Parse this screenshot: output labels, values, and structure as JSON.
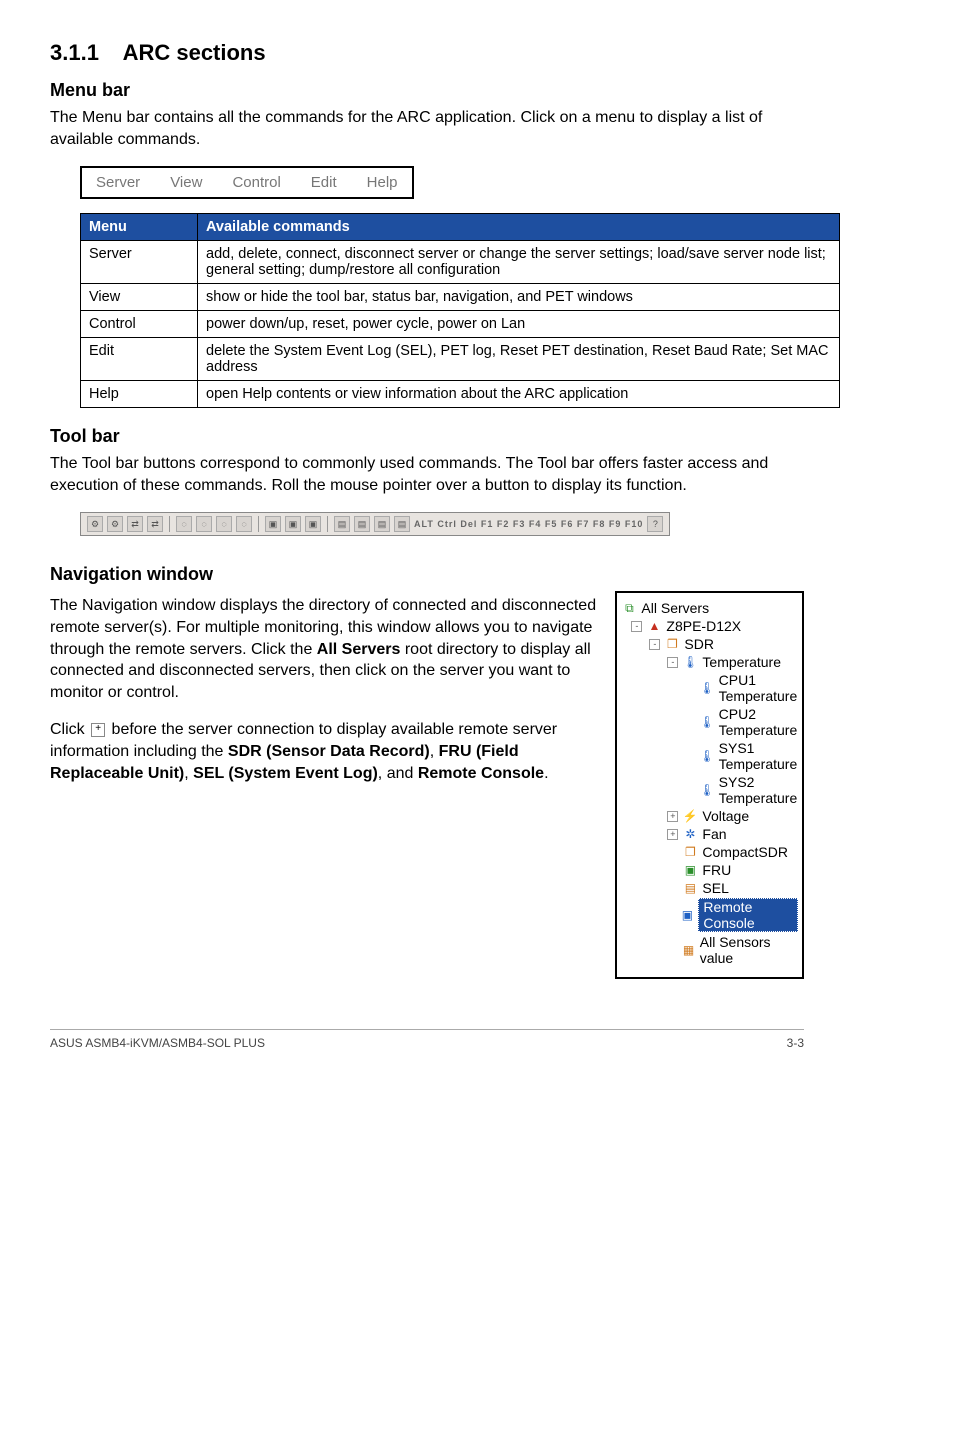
{
  "heading": {
    "num": "3.1.1",
    "title": "ARC sections"
  },
  "menubar": {
    "title": "Menu bar",
    "body": "The Menu bar contains all the commands for the ARC application. Click on a menu to display a list of available commands.",
    "items": [
      "Server",
      "View",
      "Control",
      "Edit",
      "Help"
    ]
  },
  "commands_table": {
    "head_menu": "Menu",
    "head_avail": "Available commands",
    "rows": [
      {
        "menu": "Server",
        "desc": "add, delete, connect, disconnect server or change the server settings; load/save server node list; general setting; dump/restore all configuration"
      },
      {
        "menu": "View",
        "desc": "show or hide the tool bar, status bar, navigation, and PET windows"
      },
      {
        "menu": "Control",
        "desc": "power down/up, reset, power cycle, power on Lan"
      },
      {
        "menu": "Edit",
        "desc": "delete the System Event Log (SEL), PET log, Reset PET destination, Reset Baud Rate; Set MAC address"
      },
      {
        "menu": "Help",
        "desc": "open Help contents or view information about the ARC application"
      }
    ]
  },
  "toolbar": {
    "title": "Tool bar",
    "body": "The Tool bar buttons correspond to commonly used commands. The Tool bar offers faster access and execution of these commands. Roll the mouse pointer over a button to display its function.",
    "key_labels": "ALT Ctrl Del F1 F2 F3 F4 F5 F6 F7 F8 F9 F10"
  },
  "navigation": {
    "title": "Navigation window",
    "p1_a": "The Navigation window displays the directory of connected and disconnected remote server(s). For multiple monitoring, this window allows you to navigate through the remote servers. Click the ",
    "p1_bold": "All Servers",
    "p1_b": " root directory to display all connected and disconnected servers, then click on the server you want to monitor or control.",
    "p2_a": "Click ",
    "p2_b": " before the server connection to display available remote server information including the ",
    "p2_sdr": "SDR (Sensor Data Record)",
    "p2_c": ", ",
    "p2_fru": "FRU (Field Replaceable Unit)",
    "p2_d": ", ",
    "p2_sel": "SEL (System Event Log)",
    "p2_e": ", and ",
    "p2_rc": "Remote Console",
    "p2_f": ".",
    "tree": {
      "root": "All Servers",
      "server": "Z8PE-D12X",
      "sdr": "SDR",
      "temp": "Temperature",
      "cpu1": "CPU1 Temperature",
      "cpu2": "CPU2 Temperature",
      "sys1": "SYS1 Temperature",
      "sys2": "SYS2 Temperature",
      "voltage": "Voltage",
      "fan": "Fan",
      "csdr": "CompactSDR",
      "fru": "FRU",
      "sel": "SEL",
      "remote": "Remote Console",
      "allsens": "All Sensors value"
    }
  },
  "footer": {
    "left": "ASUS ASMB4-iKVM/ASMB4-SOL PLUS",
    "right": "3-3"
  }
}
